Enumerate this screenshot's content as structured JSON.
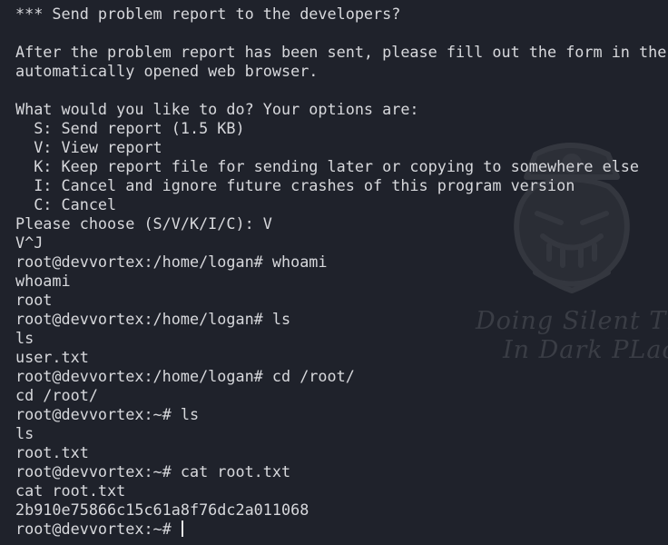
{
  "terminal": {
    "lines": [
      "*** Send problem report to the developers?",
      "",
      "After the problem report has been sent, please fill out the form in the",
      "automatically opened web browser.",
      "",
      "What would you like to do? Your options are:",
      "  S: Send report (1.5 KB)",
      "  V: View report",
      "  K: Keep report file for sending later or copying to somewhere else",
      "  I: Cancel and ignore future crashes of this program version",
      "  C: Cancel",
      "Please choose (S/V/K/I/C): V",
      "V^J",
      "root@devvortex:/home/logan# whoami",
      "whoami",
      "root",
      "root@devvortex:/home/logan# ls",
      "ls",
      "user.txt",
      "root@devvortex:/home/logan# cd /root/",
      "cd /root/",
      "root@devvortex:~# ls",
      "ls",
      "root.txt",
      "root@devvortex:~# cat root.txt",
      "cat root.txt",
      "2b910e75866c15c61a8f76dc2a011068",
      "root@devvortex:~# "
    ]
  },
  "watermark": {
    "line1": "Doing Silent Th",
    "line2": "In Dark PLac"
  }
}
